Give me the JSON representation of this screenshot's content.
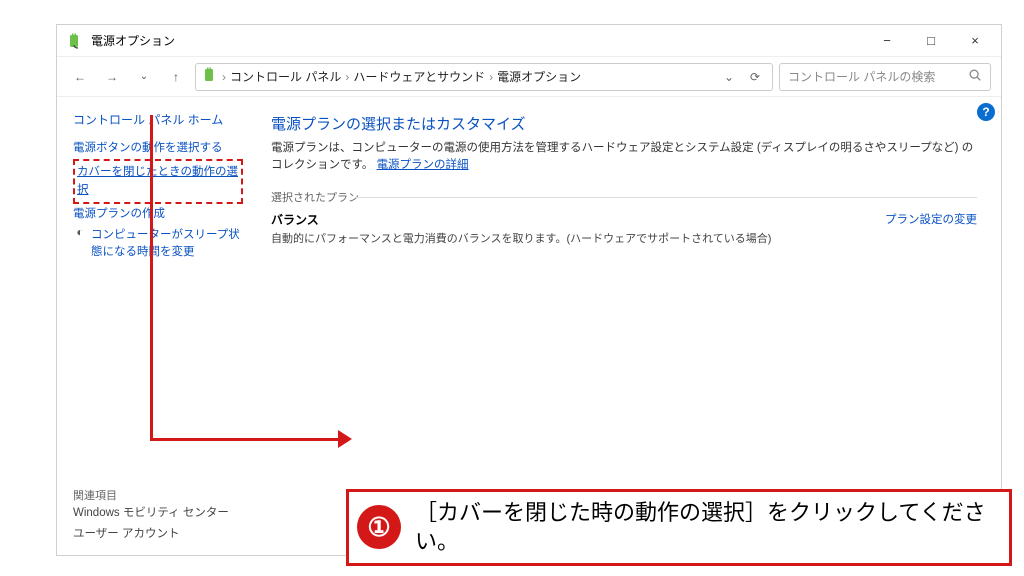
{
  "window": {
    "title": "電源オプション",
    "min": "−",
    "max": "□",
    "close": "×"
  },
  "addressbar": {
    "crumbs": [
      "コントロール パネル",
      "ハードウェアとサウンド",
      "電源オプション"
    ],
    "sep": "›",
    "dropdown": "⌄",
    "refresh": "⟳"
  },
  "search": {
    "placeholder": "コントロール パネルの検索"
  },
  "nav": {
    "back": "←",
    "fwd": "→",
    "up": "↑"
  },
  "sidebar": {
    "home": "コントロール パネル ホーム",
    "links": {
      "power_button": "電源ボタンの動作を選択する",
      "lid_close": "カバーを閉じたときの動作の選択",
      "create_plan": "電源プランの作成",
      "sleep_time": "コンピューターがスリープ状態になる時間を変更"
    },
    "see_also_header": "関連項目",
    "see_also": {
      "mobility": "Windows モビリティ センター",
      "user_accounts": "ユーザー アカウント"
    }
  },
  "main": {
    "heading": "電源プランの選択またはカスタマイズ",
    "desc_a": "電源プランは、コンピューターの電源の使用方法を管理するハードウェア設定とシステム設定 (ディスプレイの明るさやスリープなど) のコレクションです。",
    "desc_link": "電源プランの詳細",
    "selected_label": "選択されたプラン",
    "plan_name": "バランス",
    "plan_desc": "自動的にパフォーマンスと電力消費のバランスを取ります。(ハードウェアでサポートされている場合)",
    "plan_settings_link": "プラン設定の変更",
    "help": "?"
  },
  "callout": {
    "num": "①",
    "text": "［カバーを閉じた時の動作の選択］をクリックしてください。"
  },
  "icons": {
    "power_app": "battery-plug-icon",
    "sleep": "◐"
  }
}
